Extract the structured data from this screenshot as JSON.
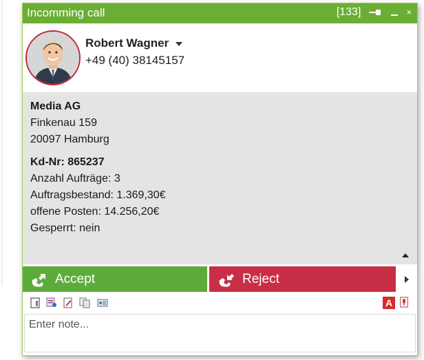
{
  "window": {
    "title": "Incomming call",
    "call_count": "[133]"
  },
  "caller": {
    "name": "Robert Wagner",
    "phone": "+49 (40) 38145157"
  },
  "company": {
    "name": "Media AG",
    "street": "Finkenau 159",
    "city": "20097 Hamburg"
  },
  "customer": {
    "number_label": "Kd-Nr: 865237",
    "orders": "Anzahl Aufträge: 3",
    "order_backlog": "Auftragsbestand: 1.369,30€",
    "open_items": "offene Posten: 14.256,20€",
    "blocked": "Gesperrt: nein"
  },
  "actions": {
    "accept_label": "Accept",
    "reject_label": "Reject"
  },
  "toolbar": {
    "icons": [
      "contact-card-icon",
      "person-list-icon",
      "edit-document-icon",
      "copy-documents-icon",
      "id-card-icon",
      "text-format-icon",
      "note-pin-icon"
    ],
    "text_format_letter": "A"
  },
  "note": {
    "placeholder": "Enter note..."
  },
  "colors": {
    "titlebar": "#6aae34",
    "accept": "#5dac3b",
    "reject": "#c92e47",
    "info_bg": "#e4e4e4",
    "avatar_ring": "#c0263a"
  }
}
